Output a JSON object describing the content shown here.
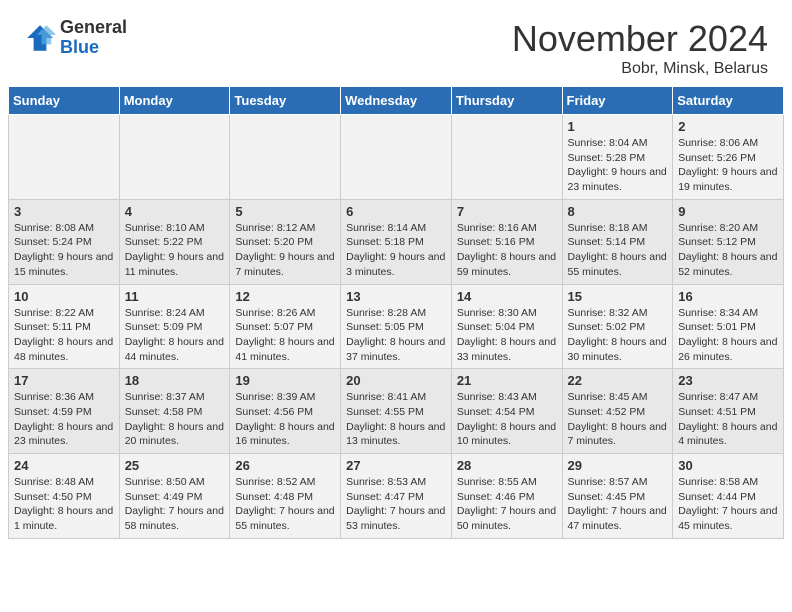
{
  "logo": {
    "general": "General",
    "blue": "Blue"
  },
  "title": "November 2024",
  "subtitle": "Bobr, Minsk, Belarus",
  "days_of_week": [
    "Sunday",
    "Monday",
    "Tuesday",
    "Wednesday",
    "Thursday",
    "Friday",
    "Saturday"
  ],
  "weeks": [
    [
      {
        "day": "",
        "info": ""
      },
      {
        "day": "",
        "info": ""
      },
      {
        "day": "",
        "info": ""
      },
      {
        "day": "",
        "info": ""
      },
      {
        "day": "",
        "info": ""
      },
      {
        "day": "1",
        "info": "Sunrise: 8:04 AM\nSunset: 5:28 PM\nDaylight: 9 hours and 23 minutes."
      },
      {
        "day": "2",
        "info": "Sunrise: 8:06 AM\nSunset: 5:26 PM\nDaylight: 9 hours and 19 minutes."
      }
    ],
    [
      {
        "day": "3",
        "info": "Sunrise: 8:08 AM\nSunset: 5:24 PM\nDaylight: 9 hours and 15 minutes."
      },
      {
        "day": "4",
        "info": "Sunrise: 8:10 AM\nSunset: 5:22 PM\nDaylight: 9 hours and 11 minutes."
      },
      {
        "day": "5",
        "info": "Sunrise: 8:12 AM\nSunset: 5:20 PM\nDaylight: 9 hours and 7 minutes."
      },
      {
        "day": "6",
        "info": "Sunrise: 8:14 AM\nSunset: 5:18 PM\nDaylight: 9 hours and 3 minutes."
      },
      {
        "day": "7",
        "info": "Sunrise: 8:16 AM\nSunset: 5:16 PM\nDaylight: 8 hours and 59 minutes."
      },
      {
        "day": "8",
        "info": "Sunrise: 8:18 AM\nSunset: 5:14 PM\nDaylight: 8 hours and 55 minutes."
      },
      {
        "day": "9",
        "info": "Sunrise: 8:20 AM\nSunset: 5:12 PM\nDaylight: 8 hours and 52 minutes."
      }
    ],
    [
      {
        "day": "10",
        "info": "Sunrise: 8:22 AM\nSunset: 5:11 PM\nDaylight: 8 hours and 48 minutes."
      },
      {
        "day": "11",
        "info": "Sunrise: 8:24 AM\nSunset: 5:09 PM\nDaylight: 8 hours and 44 minutes."
      },
      {
        "day": "12",
        "info": "Sunrise: 8:26 AM\nSunset: 5:07 PM\nDaylight: 8 hours and 41 minutes."
      },
      {
        "day": "13",
        "info": "Sunrise: 8:28 AM\nSunset: 5:05 PM\nDaylight: 8 hours and 37 minutes."
      },
      {
        "day": "14",
        "info": "Sunrise: 8:30 AM\nSunset: 5:04 PM\nDaylight: 8 hours and 33 minutes."
      },
      {
        "day": "15",
        "info": "Sunrise: 8:32 AM\nSunset: 5:02 PM\nDaylight: 8 hours and 30 minutes."
      },
      {
        "day": "16",
        "info": "Sunrise: 8:34 AM\nSunset: 5:01 PM\nDaylight: 8 hours and 26 minutes."
      }
    ],
    [
      {
        "day": "17",
        "info": "Sunrise: 8:36 AM\nSunset: 4:59 PM\nDaylight: 8 hours and 23 minutes."
      },
      {
        "day": "18",
        "info": "Sunrise: 8:37 AM\nSunset: 4:58 PM\nDaylight: 8 hours and 20 minutes."
      },
      {
        "day": "19",
        "info": "Sunrise: 8:39 AM\nSunset: 4:56 PM\nDaylight: 8 hours and 16 minutes."
      },
      {
        "day": "20",
        "info": "Sunrise: 8:41 AM\nSunset: 4:55 PM\nDaylight: 8 hours and 13 minutes."
      },
      {
        "day": "21",
        "info": "Sunrise: 8:43 AM\nSunset: 4:54 PM\nDaylight: 8 hours and 10 minutes."
      },
      {
        "day": "22",
        "info": "Sunrise: 8:45 AM\nSunset: 4:52 PM\nDaylight: 8 hours and 7 minutes."
      },
      {
        "day": "23",
        "info": "Sunrise: 8:47 AM\nSunset: 4:51 PM\nDaylight: 8 hours and 4 minutes."
      }
    ],
    [
      {
        "day": "24",
        "info": "Sunrise: 8:48 AM\nSunset: 4:50 PM\nDaylight: 8 hours and 1 minute."
      },
      {
        "day": "25",
        "info": "Sunrise: 8:50 AM\nSunset: 4:49 PM\nDaylight: 7 hours and 58 minutes."
      },
      {
        "day": "26",
        "info": "Sunrise: 8:52 AM\nSunset: 4:48 PM\nDaylight: 7 hours and 55 minutes."
      },
      {
        "day": "27",
        "info": "Sunrise: 8:53 AM\nSunset: 4:47 PM\nDaylight: 7 hours and 53 minutes."
      },
      {
        "day": "28",
        "info": "Sunrise: 8:55 AM\nSunset: 4:46 PM\nDaylight: 7 hours and 50 minutes."
      },
      {
        "day": "29",
        "info": "Sunrise: 8:57 AM\nSunset: 4:45 PM\nDaylight: 7 hours and 47 minutes."
      },
      {
        "day": "30",
        "info": "Sunrise: 8:58 AM\nSunset: 4:44 PM\nDaylight: 7 hours and 45 minutes."
      }
    ]
  ]
}
